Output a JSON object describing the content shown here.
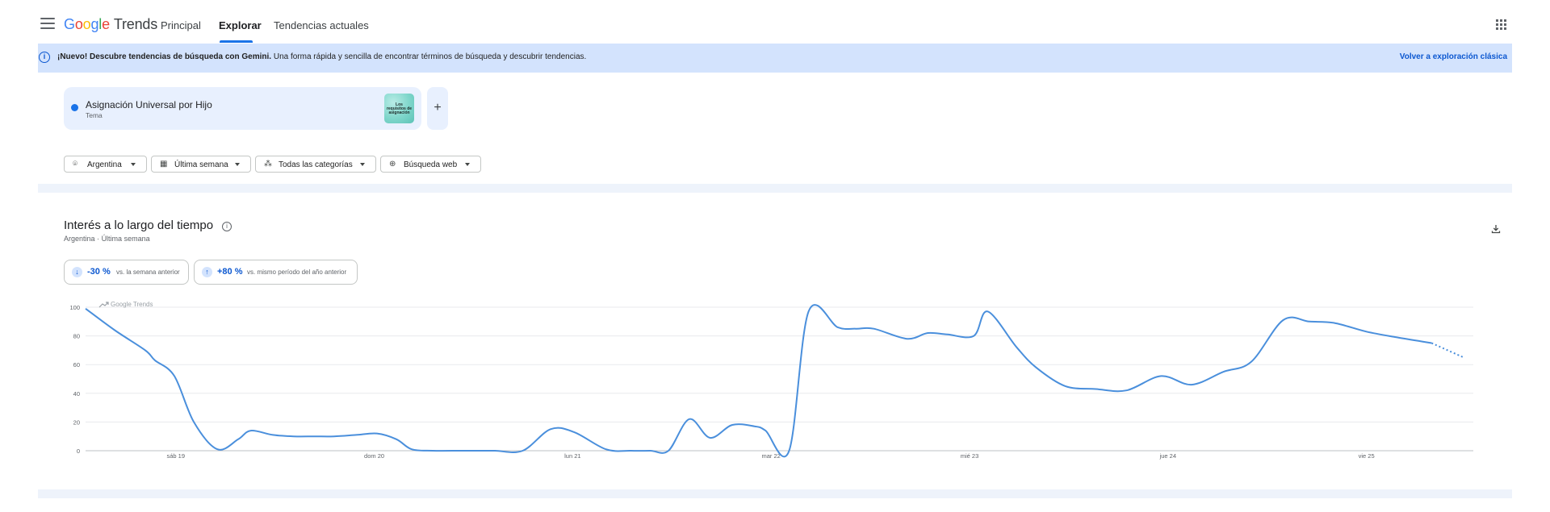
{
  "header": {
    "logo_letters": [
      "G",
      "o",
      "o",
      "g",
      "l",
      "e"
    ],
    "logo_product": "Trends",
    "tabs": [
      {
        "label": "Principal",
        "active": false
      },
      {
        "label": "Explorar",
        "active": true
      },
      {
        "label": "Tendencias actuales",
        "active": false
      }
    ]
  },
  "banner": {
    "bold": "¡Nuevo! Descubre tendencias de búsqueda con Gemini.",
    "text": " Una forma rápida y sencilla de encontrar términos de búsqueda y descubrir tendencias.",
    "link": "Volver a exploración clásica"
  },
  "term": {
    "name": "Asignación Universal por Hijo",
    "type": "Tema",
    "color": "#1a73e8",
    "thumb_text": "Los requisitos de asignación"
  },
  "filters": [
    {
      "icon": "location-pin-icon",
      "label": "Argentina"
    },
    {
      "icon": "calendar-icon",
      "label": "Última semana"
    },
    {
      "icon": "categories-icon",
      "label": "Todas las categorías"
    },
    {
      "icon": "globe-icon",
      "label": "Búsqueda web"
    }
  ],
  "section": {
    "title": "Interés a lo largo del tiempo",
    "subtitle_region": "Argentina",
    "subtitle_separator": "·",
    "subtitle_period": "Última semana"
  },
  "stats": [
    {
      "direction": "down",
      "value": "-30 %",
      "desc": "vs. la semana anterior"
    },
    {
      "direction": "up",
      "value": "+80 %",
      "desc": "vs. mismo período del año anterior"
    }
  ],
  "chart_data": {
    "type": "line",
    "watermark": "Google Trends",
    "ylim": [
      0,
      100
    ],
    "yticks": [
      0,
      20,
      40,
      60,
      80,
      100
    ],
    "xticks": [
      {
        "label": "sáb 19",
        "x": 0.65
      },
      {
        "label": "dom 20",
        "x": 2.08
      },
      {
        "label": "lun 21",
        "x": 3.51
      },
      {
        "label": "mar 22",
        "x": 4.94
      },
      {
        "label": "mié 23",
        "x": 6.37
      },
      {
        "label": "jue 24",
        "x": 7.8
      },
      {
        "label": "vie 25",
        "x": 9.23
      }
    ],
    "xrange": [
      0,
      10
    ],
    "series": [
      {
        "color": "#4a8fdc",
        "x": [
          0,
          0.21,
          0.43,
          0.5,
          0.64,
          0.78,
          0.95,
          1.1,
          1.19,
          1.35,
          1.5,
          1.65,
          1.79,
          1.95,
          2.1,
          2.24,
          2.35,
          2.5,
          2.7,
          2.8,
          2.95,
          3.15,
          3.35,
          3.52,
          3.75,
          3.93,
          4.07,
          4.2,
          4.35,
          4.5,
          4.66,
          4.82,
          4.9,
          5.07,
          5.21,
          5.42,
          5.55,
          5.68,
          5.92,
          6.07,
          6.21,
          6.4,
          6.5,
          6.71,
          6.85,
          7.06,
          7.28,
          7.5,
          7.75,
          7.97,
          8.2,
          8.4,
          8.63,
          8.82,
          9.0,
          9.23,
          9.45,
          9.7,
          9.93
        ],
        "y": [
          99,
          84,
          70,
          63,
          52,
          20,
          1,
          8,
          14,
          11,
          10,
          10,
          10,
          11,
          12,
          8,
          1,
          0,
          0,
          0,
          0,
          0,
          15,
          13,
          1,
          0,
          0,
          0,
          22,
          9,
          18,
          17,
          14,
          0,
          97,
          86,
          85,
          85,
          78,
          82,
          81,
          80,
          97,
          72,
          58,
          45,
          43,
          42,
          52,
          46,
          55,
          62,
          91,
          90,
          89,
          83,
          79,
          75,
          65
        ]
      }
    ],
    "partial_from_index": 57,
    "gridlines": true,
    "legend": "none"
  }
}
